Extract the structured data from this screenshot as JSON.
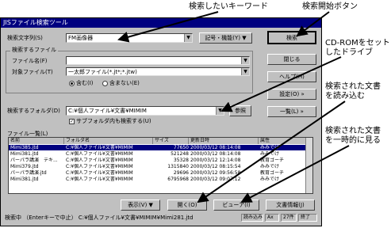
{
  "window": {
    "title": "JISファイル検索ツール"
  },
  "search": {
    "label": "検索文字列(S)",
    "value": "FM画像器",
    "symbol_button": "記号・機能(Y)",
    "search_button": "検索",
    "close_button": "閉じる",
    "help_button": "ヘルプ(H)",
    "settings_button": "設定(O)",
    "list_button": "一覧(L)"
  },
  "file_group": {
    "title": "検索するファイル",
    "filename_label": "ファイル名(F)",
    "filename_value": "",
    "filetype_label": "対象ファイル(T)",
    "filetype_value": "一太郎ファイル(*.jt*;*.jtw)",
    "radio_include": "含む(I)",
    "radio_exclude": "含まない(E)"
  },
  "folder": {
    "label": "検索するフォルダ(D)",
    "value": "C:¥個人ファイル¥文書¥MIMIM",
    "browse_button": "参照",
    "subfolder_label": "サブフォルダ内も検索する(U)"
  },
  "list": {
    "title": "ファイル一覧(L)",
    "columns": [
      "名前",
      "フォルダ名",
      "サイズ",
      "更新日時",
      "属性"
    ],
    "rows": [
      [
        "Mimi385.jtd",
        "C:¥個人ファイル¥文書¥MIMIM",
        "77650",
        "2000/03/12 08:14:08",
        "みみでけ"
      ],
      [
        "Mimi381.jtd",
        "C:¥個人ファイル¥文書¥MIMIM",
        "521248",
        "2000/03/12 08:14:08",
        "みみでけ"
      ],
      [
        "パーパラ講演　テキ...",
        "C:¥個人ファイル¥文書¥MIMIM",
        "35328",
        "2000/03/12 12:14:08",
        "教育ゴーチ"
      ],
      [
        "Mimi379.jtd",
        "C:¥個人ファイル¥文書¥MIMIM",
        "1315840",
        "2000/03/12 08:15:54",
        "みみでけ"
      ],
      [
        "パーパラ講演.jtd",
        "C:¥個人ファイル¥文書¥MIMIM",
        "29696",
        "2000/03/12 09:56:58",
        "教育ゴーチ"
      ],
      [
        "Mimi381.jtd",
        "C:¥個人ファイル¥文書¥MIMIM",
        "6795968",
        "2000/03/12 09:07:12",
        "みみでけ"
      ]
    ]
  },
  "bottom_buttons": {
    "display": "表示(V)",
    "open": "開く(O)",
    "viewer": "ビューア(I)",
    "info": "文書情報(J)"
  },
  "status": {
    "text": "検索中 （Enterキーで中止） C:¥個人ファイル¥文書¥MIMIM¥Mimi281.jtd",
    "panels": [
      "読み込み",
      "Ax",
      "27件",
      "終了"
    ]
  },
  "callouts": {
    "keyword": "検索したいキーワード",
    "start": "検索開始ボタン",
    "cdrom": "CD-ROMをセット\nしたドライブ",
    "read": "検索された文書\nを読み込む",
    "view": "検索された文書\nを一時的に見る"
  }
}
